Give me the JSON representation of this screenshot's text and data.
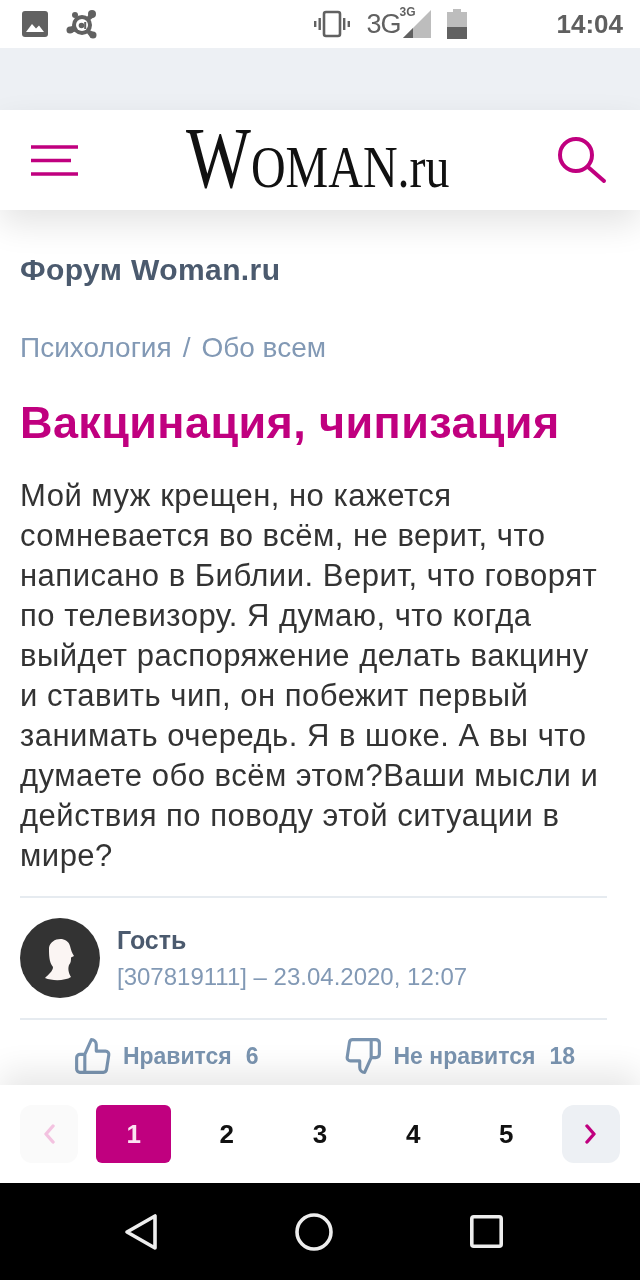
{
  "status_bar": {
    "network": "3G",
    "network_small": "3G",
    "time": "14:04"
  },
  "header": {
    "logo": "WOMAN.ru"
  },
  "forum_title": "Форум Woman.ru",
  "breadcrumbs": {
    "items": [
      {
        "label": "Психология"
      },
      {
        "label": "Обо всем"
      }
    ],
    "separator": "/"
  },
  "post": {
    "title": "Вакцинация, чипизация",
    "body": "Мой муж крещен, но кажется сомневается во всём, не верит, что написано в Библии. Верит, что говорят по телевизору. Я думаю, что когда выйдет распоряжение делать вакцину и ставить чип, он побежит первый занимать очередь. Я в шоке. А вы что думаете обо всём этом?Ваши мысли и действия по поводу этой ситуации в мире?",
    "author": "Гость",
    "meta": "[307819111] – 23.04.2020, 12:07",
    "reactions": [
      {
        "kind": "like",
        "label": "Нравится",
        "count": "6"
      },
      {
        "kind": "dislike",
        "label": "Не нравится",
        "count": "18"
      }
    ]
  },
  "pagination": {
    "prev": {
      "disabled": true
    },
    "pages": [
      {
        "label": "1",
        "selected": true
      },
      {
        "label": "2",
        "selected": false
      },
      {
        "label": "3",
        "selected": false
      },
      {
        "label": "4",
        "selected": false
      },
      {
        "label": "5",
        "selected": false
      }
    ],
    "next": {
      "disabled": false
    }
  }
}
